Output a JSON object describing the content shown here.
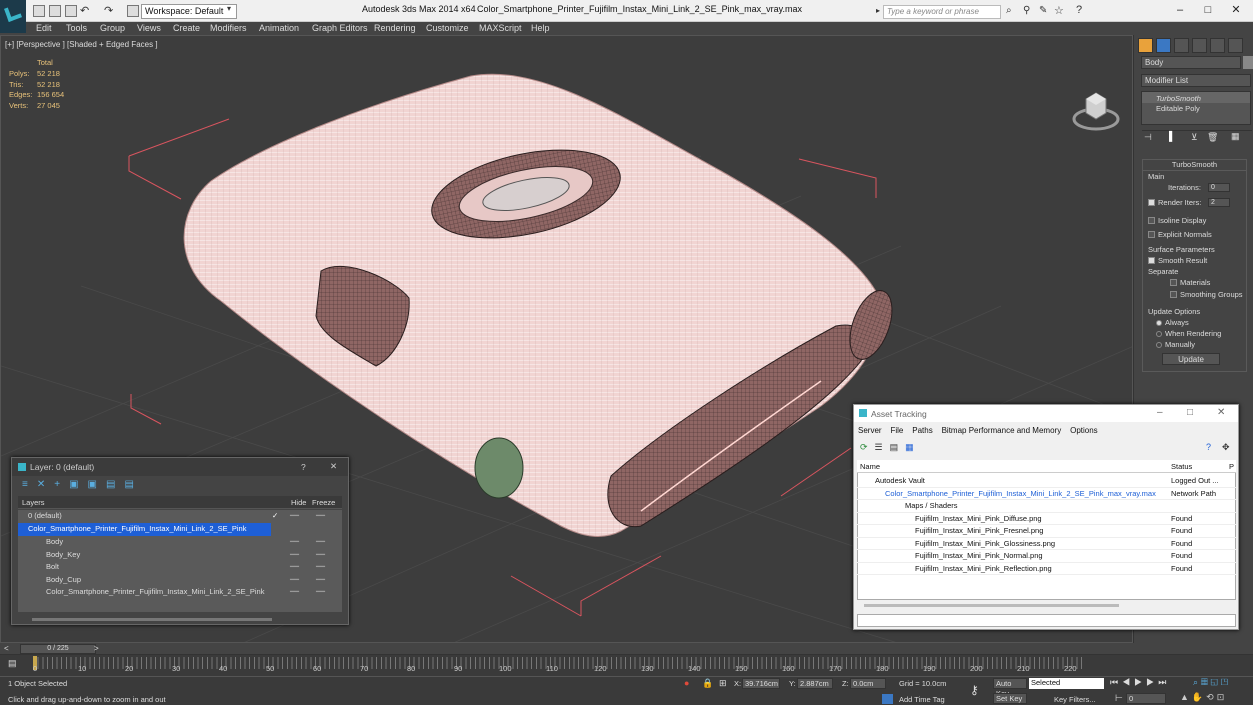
{
  "titlebar": {
    "workspace": "Workspace: Default",
    "app_title": "Autodesk 3ds Max  2014 x64",
    "file_title": "Color_Smartphone_Printer_Fujifilm_Instax_Mini_Link_2_SE_Pink_max_vray.max",
    "search_placeholder": "Type a keyword or phrase"
  },
  "menu": [
    "Edit",
    "Tools",
    "Group",
    "Views",
    "Create",
    "Modifiers",
    "Animation",
    "Graph Editors",
    "Rendering",
    "Customize",
    "MAXScript",
    "Help"
  ],
  "viewport": {
    "label": "[+] [Perspective ] [Shaded + Edged Faces ]",
    "stats_header": "Total",
    "stats": [
      {
        "label": "Polys:",
        "value": "52 218"
      },
      {
        "label": "Tris:",
        "value": "52 218"
      },
      {
        "label": "Edges:",
        "value": "156 654"
      },
      {
        "label": "Verts:",
        "value": "27 045"
      }
    ]
  },
  "command_panel": {
    "object_name": "Body",
    "modifier_list": "Modifier List",
    "stack": [
      "TurboSmooth",
      "Editable Poly"
    ],
    "rollout_title": "TurboSmooth",
    "main_label": "Main",
    "iterations_label": "Iterations:",
    "iterations_value": "0",
    "render_iters_label": "Render Iters:",
    "render_iters_value": "2",
    "isoline": "Isoline Display",
    "explicit": "Explicit Normals",
    "surface_params": "Surface Parameters",
    "smooth_result": "Smooth Result",
    "separate": "Separate",
    "materials": "Materials",
    "smoothing_groups": "Smoothing Groups",
    "update_options": "Update Options",
    "always": "Always",
    "when_rendering": "When Rendering",
    "manually": "Manually",
    "update_button": "Update"
  },
  "layer_dialog": {
    "title": "Layer: 0 (default)",
    "help": "?",
    "columns": {
      "layers": "Layers",
      "hide": "Hide",
      "freeze": "Freeze"
    },
    "rows": [
      {
        "label": "0 (default)",
        "indent": 0
      },
      {
        "label": "Color_Smartphone_Printer_Fujifilm_Instax_Mini_Link_2_SE_Pink",
        "indent": 0
      },
      {
        "label": "Body",
        "indent": 1
      },
      {
        "label": "Body_Key",
        "indent": 1
      },
      {
        "label": "Bolt",
        "indent": 1
      },
      {
        "label": "Body_Cup",
        "indent": 1
      },
      {
        "label": "Color_Smartphone_Printer_Fujifilm_Instax_Mini_Link_2_SE_Pink",
        "indent": 1
      }
    ]
  },
  "asset_dialog": {
    "title": "Asset Tracking",
    "menu": [
      "Server",
      "File",
      "Paths",
      "Bitmap Performance and Memory",
      "Options"
    ],
    "col_name": "Name",
    "col_status": "Status",
    "col_p": "P",
    "rows": [
      {
        "name": "Autodesk Vault",
        "status": "Logged Out ...",
        "indent": 1
      },
      {
        "name": "Color_Smartphone_Printer_Fujifilm_Instax_Mini_Link_2_SE_Pink_max_vray.max",
        "status": "Network Path",
        "indent": 2
      },
      {
        "name": "Maps / Shaders",
        "status": "",
        "indent": 3
      },
      {
        "name": "Fujifilm_Instax_Mini_Pink_Diffuse.png",
        "status": "Found",
        "indent": 4
      },
      {
        "name": "Fujifilm_Instax_Mini_Pink_Fresnel.png",
        "status": "Found",
        "indent": 4
      },
      {
        "name": "Fujifilm_Instax_Mini_Pink_Glossiness.png",
        "status": "Found",
        "indent": 4
      },
      {
        "name": "Fujifilm_Instax_Mini_Pink_Normal.png",
        "status": "Found",
        "indent": 4
      },
      {
        "name": "Fujifilm_Instax_Mini_Pink_Reflection.png",
        "status": "Found",
        "indent": 4
      }
    ]
  },
  "timeline": {
    "frame": "0 / 225",
    "ticks": [
      "0",
      "10",
      "20",
      "30",
      "40",
      "50",
      "60",
      "70",
      "80",
      "90",
      "100",
      "110",
      "120",
      "130",
      "140",
      "150",
      "160",
      "170",
      "180",
      "190",
      "200",
      "210",
      "220"
    ]
  },
  "status": {
    "selected": "1 Object Selected",
    "hint": "Click and drag up-and-down to zoom in and out",
    "x_label": "X:",
    "x_value": "39.716cm",
    "y_label": "Y:",
    "y_value": "2.887cm",
    "z_label": "Z:",
    "z_value": "0.0cm",
    "grid": "Grid = 10.0cm",
    "add_time_tag": "Add Time Tag",
    "auto_key": "Auto Key",
    "auto_key_value": "Selected",
    "set_key": "Set Key",
    "key_filters": "Key Filters...",
    "frame_value": "0"
  }
}
